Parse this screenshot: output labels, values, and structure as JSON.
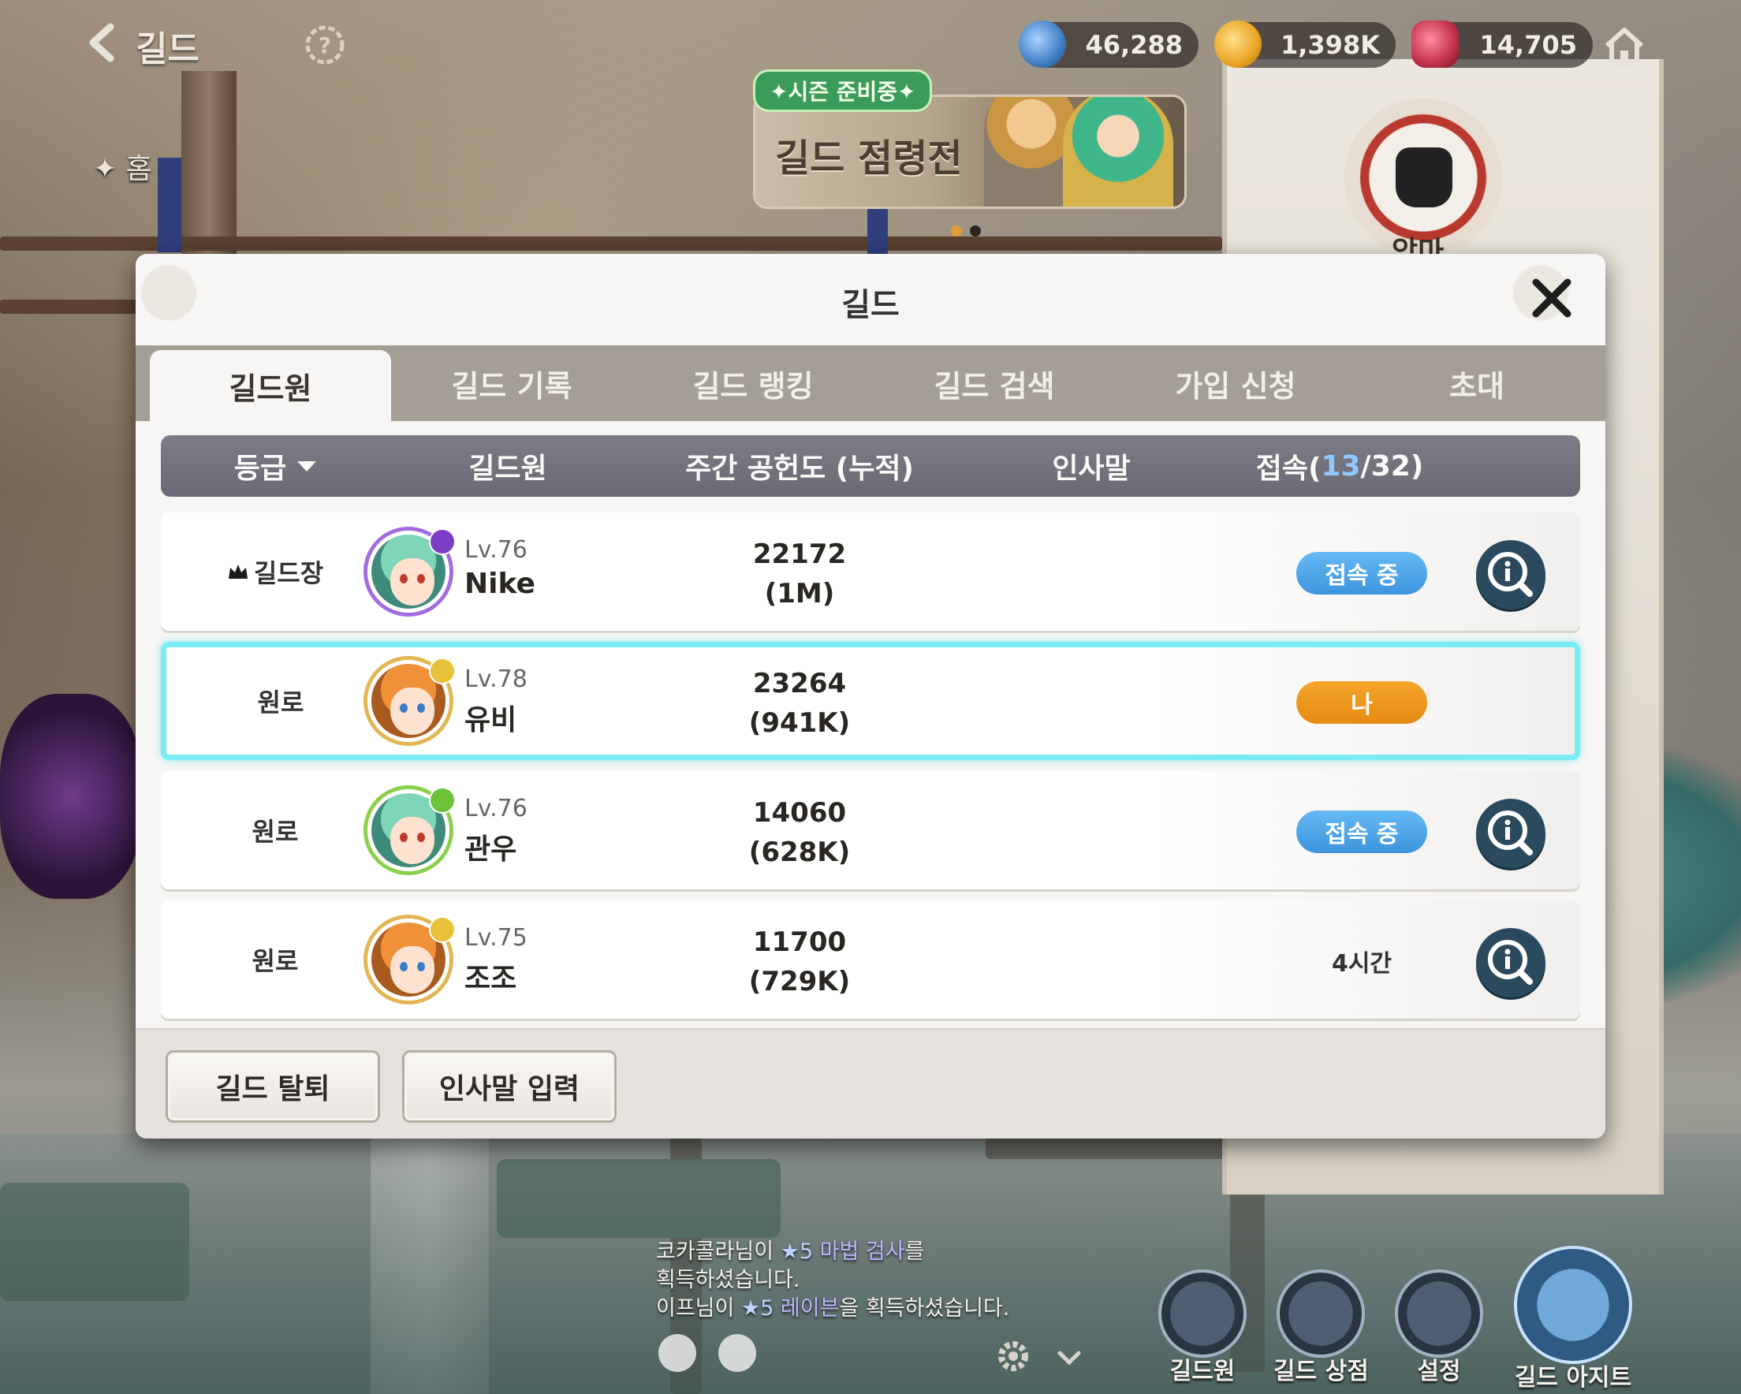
{
  "top_bar": {
    "title": "길드",
    "currencies": [
      {
        "icon": "gem-blue-icon",
        "value": "46,288",
        "color": "#3f7fc4"
      },
      {
        "icon": "gold-coin-icon",
        "value": "1,398K",
        "color": "#e9a423"
      },
      {
        "icon": "ruby-icon",
        "value": "14,705",
        "color": "#c43248"
      }
    ]
  },
  "event_banner": {
    "tag": "✦시즌 준비중✦",
    "title": "길드 점령전"
  },
  "side": {
    "emblem_label": "악마",
    "left_label": "홈"
  },
  "modal": {
    "title": "길드",
    "tabs": [
      {
        "label": "길드원",
        "active": true
      },
      {
        "label": "길드 기록",
        "active": false
      },
      {
        "label": "길드 랭킹",
        "active": false
      },
      {
        "label": "길드 검색",
        "active": false
      },
      {
        "label": "가입 신청",
        "active": false
      },
      {
        "label": "초대",
        "active": false
      }
    ],
    "header": {
      "rank": "등급",
      "member": "길드원",
      "contribution": "주간 공헌도 (누적)",
      "greeting": "인사말",
      "online_prefix": "접속(",
      "online_count": "13",
      "online_sep": "/",
      "online_total": "32",
      "online_suffix": ")"
    },
    "members": [
      {
        "rank": "길드장",
        "level": "Lv.76",
        "name": "Nike",
        "weekly": "22172",
        "total": "(1M)",
        "status": "접속 중",
        "status_type": "online"
      },
      {
        "rank": "원로",
        "level": "Lv.78",
        "name": "유비",
        "weekly": "23264",
        "total": "(941K)",
        "status": "나",
        "status_type": "me"
      },
      {
        "rank": "원로",
        "level": "Lv.76",
        "name": "관우",
        "weekly": "14060",
        "total": "(628K)",
        "status": "접속 중",
        "status_type": "online"
      },
      {
        "rank": "원로",
        "level": "Lv.75",
        "name": "조조",
        "weekly": "11700",
        "total": "(729K)",
        "status": "4시간",
        "status_type": "offline"
      }
    ],
    "footer": {
      "leave_label": "길드 탈퇴",
      "greeting_label": "인사말 입력"
    }
  },
  "chat": {
    "line1_a": "코카콜라님이 ",
    "line1_star": "★5",
    "line1_b": " 마법 검사",
    "line1_c": "를",
    "line2": "획득하셨습니다.",
    "line3_a": "이프님이 ",
    "line3_star": "★5",
    "line3_b": " 레이븐",
    "line3_c": "을 획득하셨습니다."
  },
  "bottom_menu": [
    {
      "label": "길드원",
      "icon": "members-icon"
    },
    {
      "label": "길드 상점",
      "icon": "shop-basket-icon"
    },
    {
      "label": "설정",
      "icon": "settings-gear-icon"
    },
    {
      "label": "길드 아지트",
      "icon": "guild-hideout-icon"
    }
  ]
}
